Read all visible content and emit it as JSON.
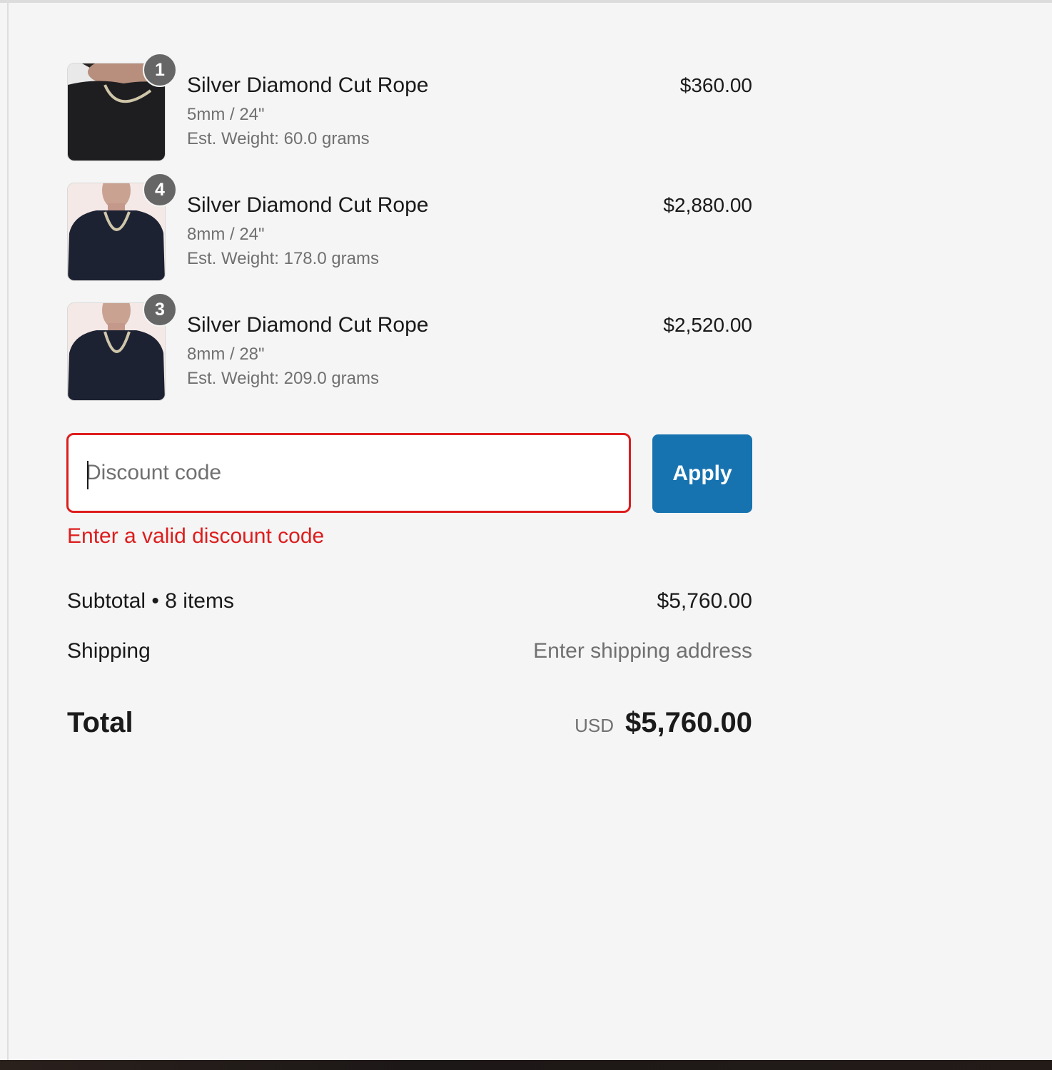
{
  "line_items": [
    {
      "title": "Silver Diamond Cut Rope",
      "variant": "5mm / 24\"",
      "weight": "Est. Weight: 60.0 grams",
      "price": "$360.00",
      "quantity": "1"
    },
    {
      "title": "Silver Diamond Cut Rope",
      "variant": "8mm / 24\"",
      "weight": "Est. Weight: 178.0 grams",
      "price": "$2,880.00",
      "quantity": "4"
    },
    {
      "title": "Silver Diamond Cut Rope",
      "variant": "8mm / 28\"",
      "weight": "Est. Weight: 209.0 grams",
      "price": "$2,520.00",
      "quantity": "3"
    }
  ],
  "discount": {
    "placeholder": "Discount code",
    "value": "",
    "apply_label": "Apply",
    "error": "Enter a valid discount code"
  },
  "summary": {
    "subtotal_label": "Subtotal • 8 items",
    "subtotal_value": "$5,760.00",
    "shipping_label": "Shipping",
    "shipping_value": "Enter shipping address",
    "total_label": "Total",
    "currency": "USD",
    "total_value": "$5,760.00"
  },
  "colors": {
    "background": "#f5f5f5",
    "error": "#dd1d1d",
    "accent": "#1773b0",
    "badge": "#666666"
  }
}
